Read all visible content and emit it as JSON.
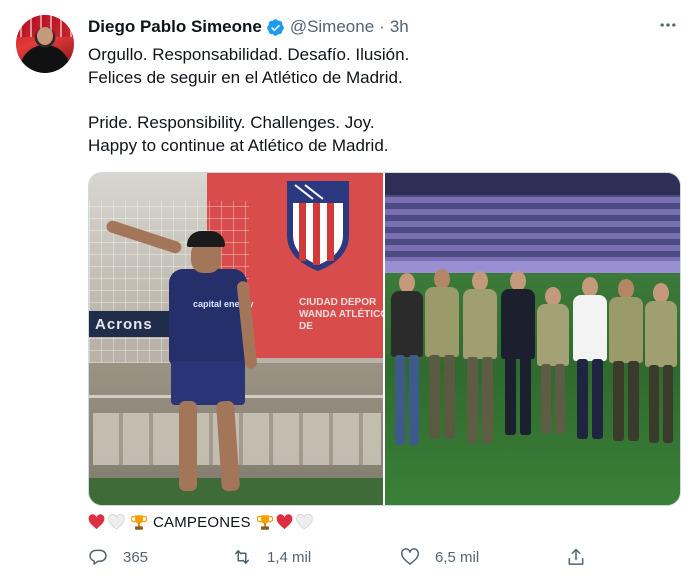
{
  "tweet": {
    "author_name": "Diego Pablo Simeone",
    "handle": "@Simeone",
    "separator": "·",
    "time": "3h",
    "text_lines": [
      "Orgullo. Responsabilidad. Desafío. Ilusión.",
      "Felices de seguir en el Atlético de Madrid.",
      "Pride. Responsibility. Challenges. Joy.",
      "Happy to continue at Atlético de Madrid."
    ],
    "emoji_word": "CAMPEONES",
    "photo1_banner_text": "Acrons",
    "photo1_shirt_text": "capital energy",
    "photo1_crest_text": "CIUDAD DEPOR WANDA ATLÉTICO DE"
  },
  "actions": {
    "reply_count": "365",
    "retweet_count": "1,4 mil",
    "like_count": "6,5 mil"
  },
  "colors": {
    "text": "#0f1419",
    "muted": "#536471",
    "verified": "#1d9bf0",
    "heart_red": "#dd2e44",
    "heart_white": "#e8e8e8",
    "trophy": "#f4a100"
  },
  "icons": {
    "verified": "verified-badge-icon",
    "more": "more-horizontal-icon",
    "reply": "reply-icon",
    "retweet": "retweet-icon",
    "like": "heart-outline-icon",
    "share": "share-icon"
  }
}
